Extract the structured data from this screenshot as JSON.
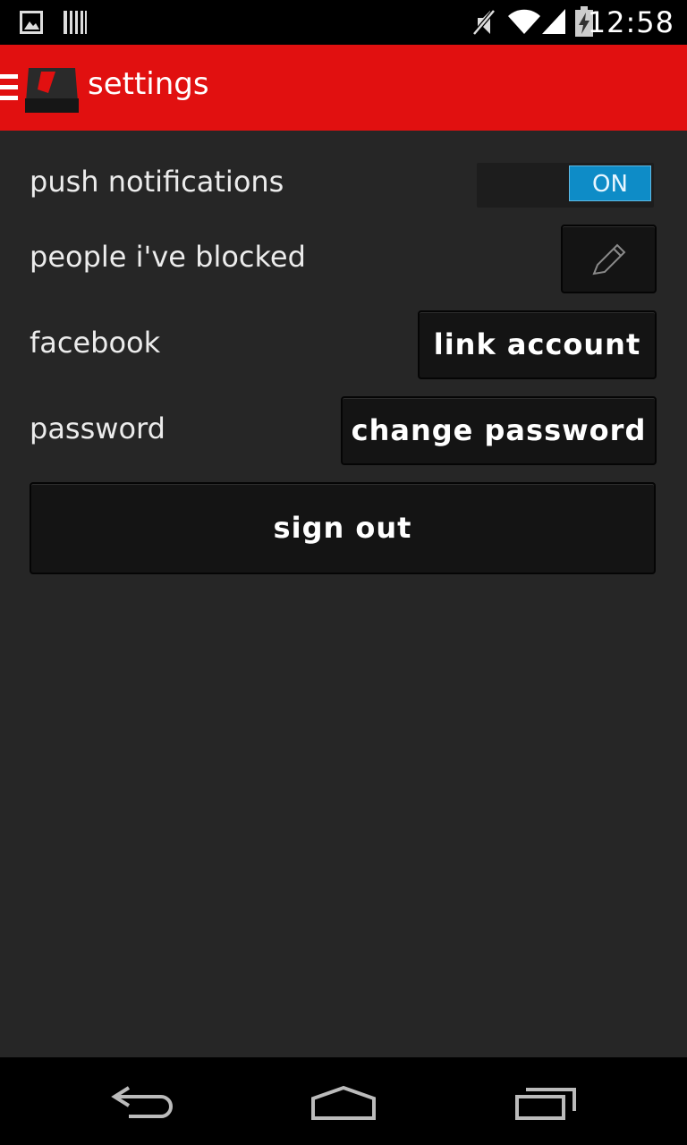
{
  "status_bar": {
    "time": "12:58",
    "icons": [
      "image-icon",
      "barcode-icon",
      "mute-icon",
      "wifi-icon",
      "signal-icon",
      "battery-charging-icon"
    ]
  },
  "action_bar": {
    "title": "settings",
    "menu_icon": "hamburger-icon",
    "logo": "app-logo"
  },
  "settings": {
    "push_notifications": {
      "label": "push notifications",
      "toggle_text": "ON",
      "toggle_state": true
    },
    "blocked": {
      "label": "people i've blocked",
      "button_icon": "pencil-icon"
    },
    "facebook": {
      "label": "facebook",
      "button_label": "link account"
    },
    "password": {
      "label": "password",
      "button_label": "change password"
    },
    "sign_out_label": "sign out"
  },
  "nav_bar": {
    "icons": [
      "back-icon",
      "home-icon",
      "recent-apps-icon"
    ]
  },
  "colors": {
    "accent": "#e11010",
    "toggle_on": "#0e8cc7",
    "background": "#262626"
  }
}
